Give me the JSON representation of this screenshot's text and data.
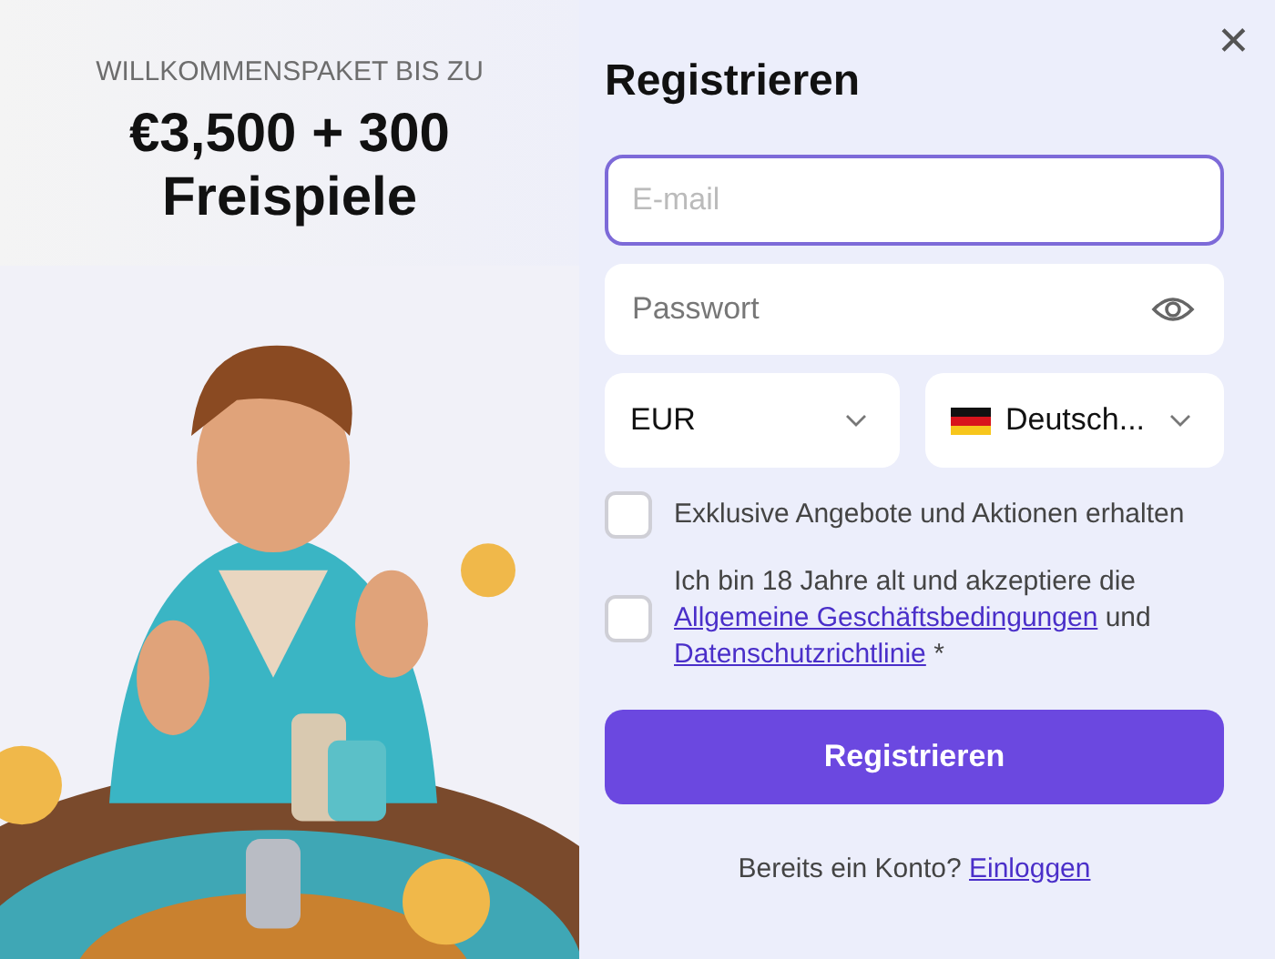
{
  "promo": {
    "eyebrow": "WILLKOMMENSPAKET BIS ZU",
    "headline": [
      "€3,500 + 300",
      "Freispiele"
    ]
  },
  "form": {
    "title": "Registrieren",
    "fields": [
      {
        "kind": "text",
        "placeholder": "E-mail",
        "focused": true
      },
      {
        "kind": "password",
        "placeholder": "Passwort",
        "focused": false
      }
    ],
    "selects": [
      {
        "kind": "plain",
        "value": "EUR"
      },
      {
        "kind": "flag",
        "value": "Deutsch..."
      }
    ],
    "checkboxes": [
      {
        "text": "Exklusive Angebote und Aktionen erhalten",
        "checked": false
      },
      {
        "text": "Ich bin 18 Jahre alt und akzeptiere die",
        "checked": false,
        "links": [
          "Allgemeine Geschäftsbedingungen",
          "und",
          "Datenschutzrichtlinie",
          "*"
        ]
      }
    ],
    "submit": "Registrieren",
    "footer": {
      "text": "Bereits ein Konto?",
      "link": "Einloggen"
    }
  },
  "close": {
    "label": "✕"
  }
}
